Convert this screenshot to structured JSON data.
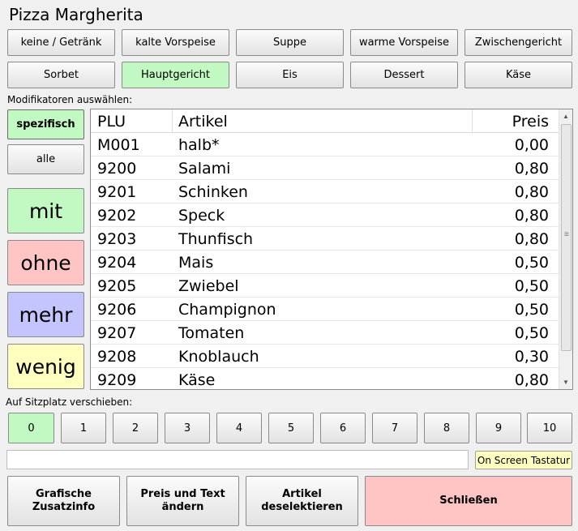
{
  "title": "Pizza Margherita",
  "courses": [
    "keine / Getränk",
    "kalte Vorspeise",
    "Suppe",
    "warme Vorspeise",
    "Zwischengericht",
    "Sorbet",
    "Hauptgericht",
    "Eis",
    "Dessert",
    "Käse"
  ],
  "selected_course": "Hauptgericht",
  "modifiers_label": "Modifikatoren auswählen:",
  "filter_buttons": {
    "specific": "spezifisch",
    "all": "alle"
  },
  "modifier_types": {
    "with": "mit",
    "without": "ohne",
    "more": "mehr",
    "less": "wenig"
  },
  "table": {
    "headers": {
      "plu": "PLU",
      "article": "Artikel",
      "price": "Preis"
    },
    "rows": [
      {
        "plu": "M001",
        "article": "halb*",
        "price": "0,00"
      },
      {
        "plu": "9200",
        "article": "Salami",
        "price": "0,80"
      },
      {
        "plu": "9201",
        "article": "Schinken",
        "price": "0,80"
      },
      {
        "plu": "9202",
        "article": "Speck",
        "price": "0,80"
      },
      {
        "plu": "9203",
        "article": "Thunfisch",
        "price": "0,80"
      },
      {
        "plu": "9204",
        "article": "Mais",
        "price": "0,50"
      },
      {
        "plu": "9205",
        "article": "Zwiebel",
        "price": "0,50"
      },
      {
        "plu": "9206",
        "article": "Champignon",
        "price": "0,50"
      },
      {
        "plu": "9207",
        "article": "Tomaten",
        "price": "0,50"
      },
      {
        "plu": "9208",
        "article": "Knoblauch",
        "price": "0,30"
      },
      {
        "plu": "9209",
        "article": "Käse",
        "price": "0,80"
      }
    ]
  },
  "seat_label": "Auf Sitzplatz verschieben:",
  "seats": [
    "0",
    "1",
    "2",
    "3",
    "4",
    "5",
    "6",
    "7",
    "8",
    "9",
    "10"
  ],
  "selected_seat": "0",
  "input": {
    "value": ""
  },
  "osk_label": "On Screen Tastatur",
  "bottom_buttons": {
    "graphic_info": "Grafische\nZusatzinfo",
    "price_text": "Preis und Text\nändern",
    "deselect": "Artikel\ndeselektieren",
    "close": "Schließen"
  },
  "colors": {
    "selected_green": "#c2f8c2",
    "ohne_pink": "#ffc4c4",
    "mehr_blue": "#c4c4ff",
    "wenig_yellow": "#ffffc0",
    "close_pink": "#ffc4c4"
  },
  "icons": {
    "scroll_up": "triangle-up",
    "scroll_down": "triangle-down",
    "grip": "three-lines"
  }
}
